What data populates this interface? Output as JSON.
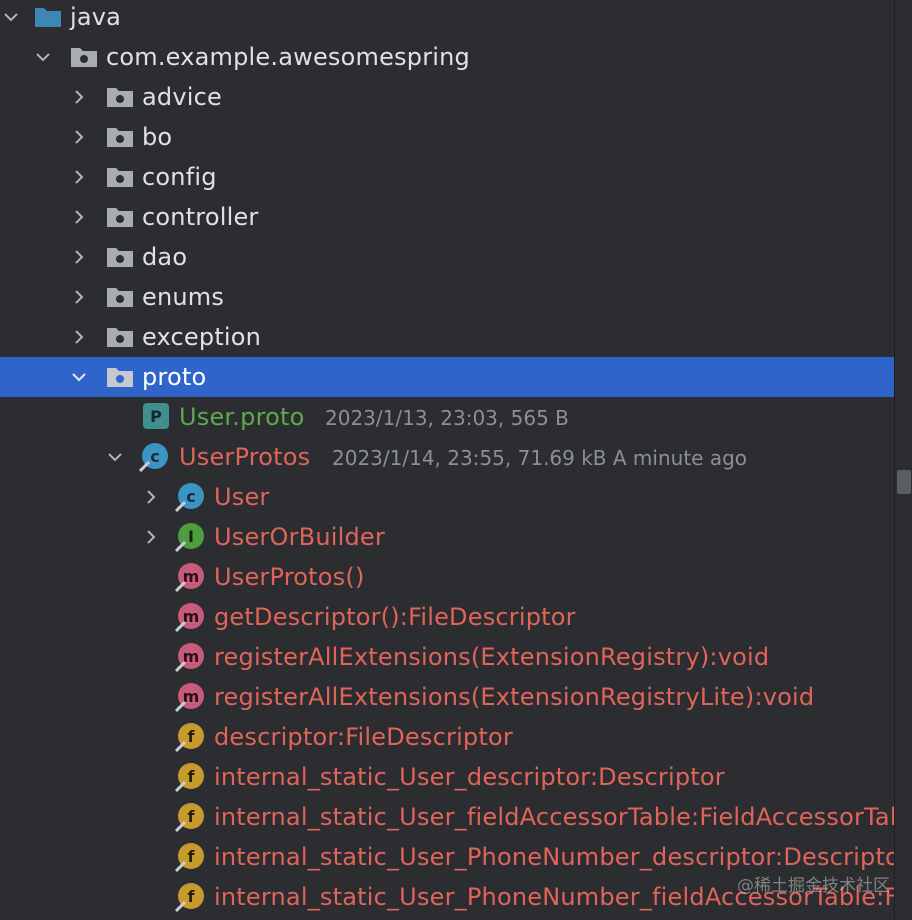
{
  "tree": {
    "java": "java",
    "package": "com.example.awesomespring",
    "folders": [
      "advice",
      "bo",
      "config",
      "controller",
      "dao",
      "enums",
      "exception"
    ],
    "proto_folder": "proto",
    "user_proto": {
      "name": "User.proto",
      "meta": "2023/1/13, 23:03, 565 B"
    },
    "user_protos": {
      "name": "UserProtos",
      "meta": "2023/1/14, 23:55, 71.69 kB A minute ago"
    },
    "members": [
      {
        "kind": "c",
        "letter": "c",
        "label": "User",
        "expandable": true
      },
      {
        "kind": "i",
        "letter": "I",
        "label": "UserOrBuilder",
        "expandable": true
      },
      {
        "kind": "m",
        "letter": "m",
        "label": "UserProtos()",
        "expandable": false
      },
      {
        "kind": "m",
        "letter": "m",
        "label": "getDescriptor():FileDescriptor",
        "expandable": false
      },
      {
        "kind": "m",
        "letter": "m",
        "label": "registerAllExtensions(ExtensionRegistry):void",
        "expandable": false
      },
      {
        "kind": "m",
        "letter": "m",
        "label": "registerAllExtensions(ExtensionRegistryLite):void",
        "expandable": false
      },
      {
        "kind": "f",
        "letter": "f",
        "label": "descriptor:FileDescriptor",
        "expandable": false
      },
      {
        "kind": "f",
        "letter": "f",
        "label": "internal_static_User_descriptor:Descriptor",
        "expandable": false
      },
      {
        "kind": "f",
        "letter": "f",
        "label": "internal_static_User_fieldAccessorTable:FieldAccessorTable",
        "expandable": false
      },
      {
        "kind": "f",
        "letter": "f",
        "label": "internal_static_User_PhoneNumber_descriptor:Descriptor",
        "expandable": false
      },
      {
        "kind": "f",
        "letter": "f",
        "label": "internal_static_User_PhoneNumber_fieldAccessorTable:FieldAccessorTable",
        "expandable": false
      }
    ]
  },
  "watermark": "@稀土掘金技术社区",
  "colors": {
    "background": "#2b2d30",
    "selection": "#2f65ca",
    "proto_file": "#5fa84f",
    "modified": "#e0645a",
    "folder_source": "#3d87b5",
    "folder_package": "#a9adb3"
  },
  "icons": {
    "chevron_right": "chevron-right-icon",
    "chevron_down": "chevron-down-icon",
    "source_folder": "source-folder-icon",
    "package_folder": "package-folder-icon",
    "proto_file": "proto-file-icon",
    "class": "class-icon",
    "interface": "interface-icon",
    "method": "method-icon",
    "field": "field-icon"
  }
}
